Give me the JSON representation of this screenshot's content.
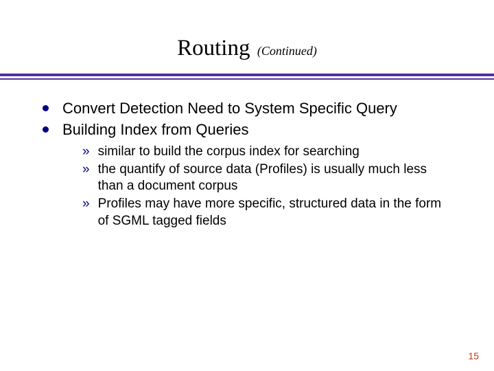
{
  "title": {
    "main": "Routing",
    "continued": "(Continued)"
  },
  "bullets": {
    "lvl1": [
      "Convert Detection Need to System Specific Query",
      "Building Index from Queries"
    ],
    "lvl2": [
      "similar to build the corpus index for searching",
      "the quantify of source data (Profiles) is usually much less than a document corpus",
      "Profiles may have more specific, structured data in the form of SGML tagged fields"
    ]
  },
  "page_number": "15",
  "colors": {
    "rule": "#53319c",
    "bullet": "#000080",
    "pagenum": "#c23a1a"
  }
}
